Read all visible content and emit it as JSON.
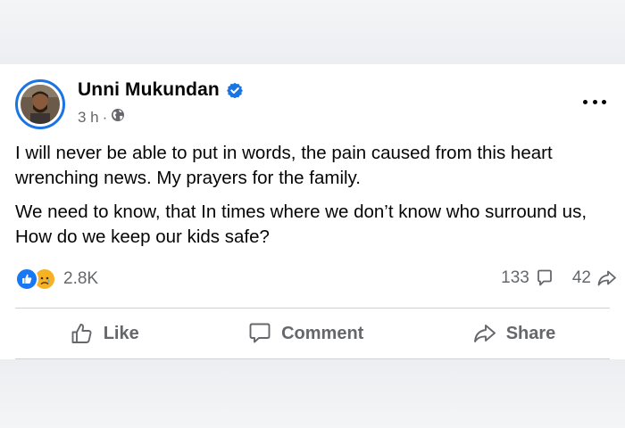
{
  "post": {
    "author_name": "Unni Mukundan",
    "time": "3 h",
    "separator": "·",
    "paragraphs": [
      "I will never be able to put in words, the pain caused from this heart wrenching news. My prayers for the family.",
      "We need to know, that In times where we don’t know who surround us, How do we keep our kids safe?"
    ]
  },
  "stats": {
    "reactions_count": "2.8K",
    "comments_count": "133",
    "shares_count": "42"
  },
  "actions": {
    "like_label": "Like",
    "comment_label": "Comment",
    "share_label": "Share"
  },
  "icons": {
    "verified": "verified-badge-icon",
    "audience": "globe-icon",
    "more": "more-options-icon",
    "like_reaction": "like-reaction-icon",
    "sad_reaction": "sad-reaction-icon",
    "comment": "comment-icon",
    "share": "share-icon"
  },
  "colors": {
    "accent": "#1877f2",
    "verified": "#1b74e4",
    "secondary_text": "#65676b",
    "sad_reaction": "#f7b125"
  }
}
